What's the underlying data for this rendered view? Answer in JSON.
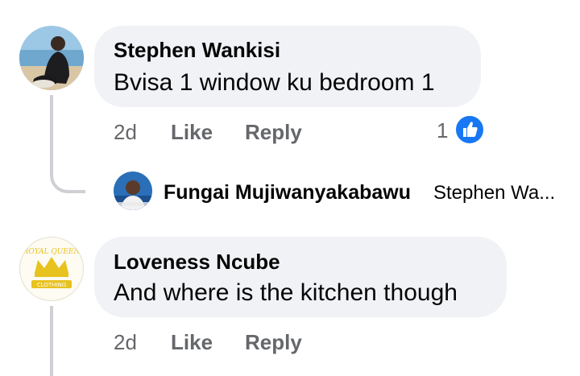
{
  "comments": [
    {
      "author": "Stephen Wankisi",
      "text": "Bvisa 1 window ku bedroom 1",
      "time": "2d",
      "like_label": "Like",
      "reply_label": "Reply",
      "reaction_count": "1",
      "reaction_icon": "thumbs-up-icon"
    },
    {
      "author": "Loveness Ncube",
      "text": "And where is the kitchen though",
      "time": "2d",
      "like_label": "Like",
      "reply_label": "Reply",
      "avatar_logo_text": "ROYAL QUEEN CLOTHING"
    }
  ],
  "reply": {
    "author": "Fungai Mujiwanyakabawu",
    "preview": "Stephen Wa..."
  },
  "colors": {
    "bubble": "#f0f2f5",
    "meta_text": "#65676b",
    "like_blue": "#1877f2",
    "thread_line": "#ced0d4",
    "logo_gold": "#e8c21f"
  }
}
